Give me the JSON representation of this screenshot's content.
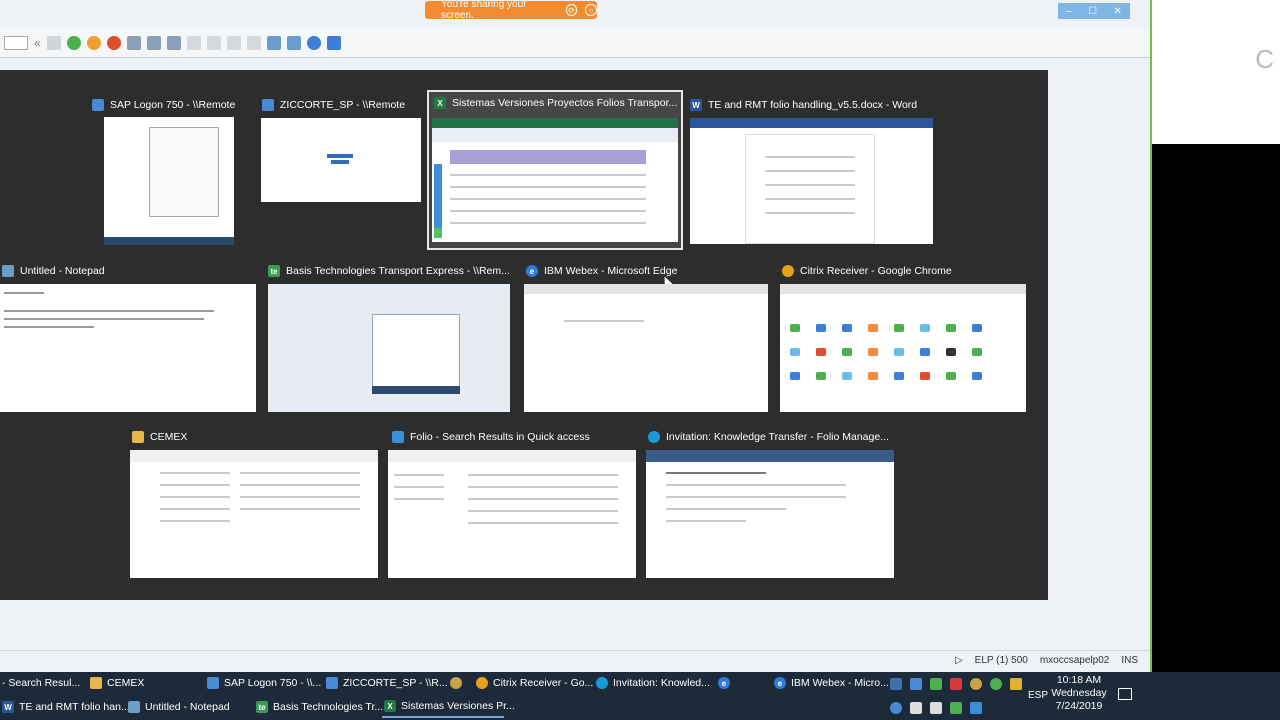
{
  "banner": {
    "text": "You're sharing your screen."
  },
  "switcher": {
    "windows": [
      {
        "id": "sap-logon",
        "title": "SAP Logon 750 - \\\\Remote",
        "icon": "sap-logon-icon",
        "color": "#4a8ad4",
        "selected": false
      },
      {
        "id": "ziccorte",
        "title": "ZICCORTE_SP - \\\\Remote",
        "icon": "sap-gui-icon",
        "color": "#4a8ad4",
        "selected": false
      },
      {
        "id": "excel",
        "title": "Sistemas Versiones Proyectos Folios Transpor...",
        "icon": "excel-icon",
        "color": "#1f7a45",
        "selected": true
      },
      {
        "id": "word",
        "title": "TE and RMT folio handling_v5.5.docx - Word",
        "icon": "word-icon",
        "color": "#2b579a",
        "selected": false
      },
      {
        "id": "notepad",
        "title": "Untitled - Notepad",
        "icon": "notepad-icon",
        "color": "#6aa0c8",
        "selected": false
      },
      {
        "id": "basis",
        "title": "Basis Technologies Transport Express - \\\\Rem...",
        "icon": "basis-te-icon",
        "color": "#3a9b54",
        "selected": false
      },
      {
        "id": "webex",
        "title": "IBM Webex - Microsoft Edge",
        "icon": "edge-icon",
        "color": "#2f7cd6",
        "selected": false
      },
      {
        "id": "citrix",
        "title": "Citrix Receiver - Google Chrome",
        "icon": "chrome-icon",
        "color": "#e3a21a",
        "selected": false
      },
      {
        "id": "cemex",
        "title": "CEMEX",
        "icon": "folder-icon",
        "color": "#e6b84a",
        "selected": false
      },
      {
        "id": "folio",
        "title": "Folio - Search Results in Quick access",
        "icon": "explorer-icon",
        "color": "#3a8fd8",
        "selected": false
      },
      {
        "id": "invitation",
        "title": "Invitation: Knowledge Transfer - Folio Manage...",
        "icon": "webex-meeting-icon",
        "color": "#1a9ad6",
        "selected": false
      }
    ]
  },
  "statusbar": {
    "system": "ELP (1) 500",
    "server": "mxoccsapelp02",
    "mode": "INS"
  },
  "taskbar": {
    "row1": [
      {
        "label": "- Search Resul...",
        "icon": "explorer-icon",
        "color": "#3a8fd8"
      },
      {
        "label": "CEMEX",
        "icon": "folder-icon",
        "color": "#e6b84a"
      },
      {
        "label": "SAP Logon 750 - \\\\...",
        "icon": "sap-logon-icon",
        "color": "#4a8ad4"
      },
      {
        "label": "ZICCORTE_SP - \\\\R...",
        "icon": "sap-gui-icon",
        "color": "#4a8ad4"
      },
      {
        "label": "Citrix Receiver - Go...",
        "icon": "chrome-icon",
        "color": "#e3a21a"
      },
      {
        "label": "Invitation: Knowled...",
        "icon": "webex-meeting-icon",
        "color": "#1a9ad6"
      },
      {
        "label": "IBM Webex - Micro...",
        "icon": "edge-icon",
        "color": "#2f7cd6"
      }
    ],
    "row2": [
      {
        "label": "TE and RMT folio han...",
        "icon": "word-icon",
        "color": "#2b579a"
      },
      {
        "label": "Untitled - Notepad",
        "icon": "notepad-icon",
        "color": "#6aa0c8"
      },
      {
        "label": "Basis Technologies Tr...",
        "icon": "basis-te-icon",
        "color": "#3a9b54"
      },
      {
        "label": "Sistemas Versiones Pr...",
        "icon": "excel-icon",
        "color": "#1f7a45"
      }
    ],
    "lang": "ESP",
    "clock": {
      "time": "10:18 AM",
      "day": "Wednesday",
      "date": "7/24/2019"
    }
  }
}
